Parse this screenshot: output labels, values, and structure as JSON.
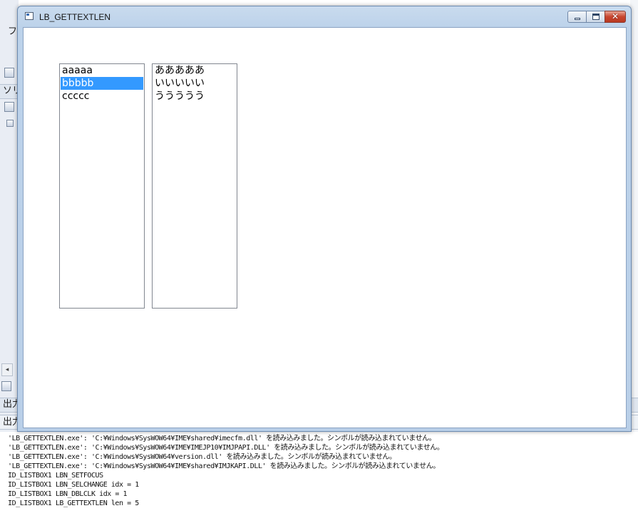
{
  "window": {
    "title": "LB_GETTEXTLEN",
    "close_glyph": "✕",
    "listbox1": {
      "items": [
        "aaaaa",
        "bbbbb",
        "ccccc"
      ],
      "selected_index": 1
    },
    "listbox2": {
      "items": [
        "あああああ",
        "いいいいい",
        "ううううう"
      ]
    }
  },
  "background_ide": {
    "fragments": {
      "menu": "フ",
      "panel": "ソリ",
      "output_tab": "出力",
      "output_header": "出力"
    },
    "scroll_left_glyph": "◂"
  },
  "output": {
    "lines": [
      "'LB_GETTEXTLEN.exe': 'C:¥Windows¥SysWOW64¥IME¥shared¥imecfm.dll' を読み込みました。シンボルが読み込まれていません。",
      "'LB_GETTEXTLEN.exe': 'C:¥Windows¥SysWOW64¥IME¥IMEJP10¥IMJPAPI.DLL' を読み込みました。シンボルが読み込まれていません。",
      "'LB_GETTEXTLEN.exe': 'C:¥Windows¥SysWOW64¥version.dll' を読み込みました。シンボルが読み込まれていません。",
      "'LB_GETTEXTLEN.exe': 'C:¥Windows¥SysWOW64¥IME¥shared¥IMJKAPI.DLL' を読み込みました。シンボルが読み込まれていません。",
      "ID_LISTBOX1 LBN_SETFOCUS",
      "ID_LISTBOX1 LBN_SELCHANGE idx = 1",
      "ID_LISTBOX1 LBN_DBLCLK idx = 1",
      "ID_LISTBOX1 LB_GETTEXTLEN len = 5"
    ]
  },
  "colors": {
    "selection": "#3399ff",
    "title_bar": "#c9dbee"
  }
}
